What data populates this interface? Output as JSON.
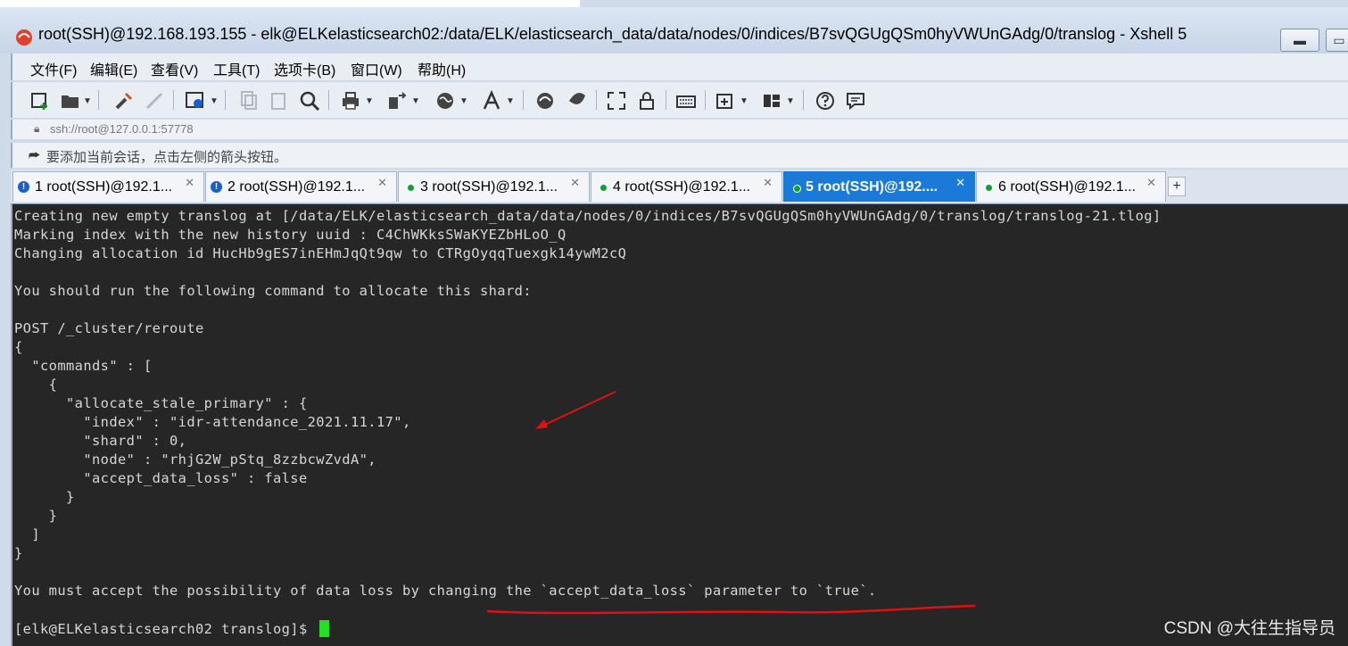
{
  "window": {
    "title": "root(SSH)@192.168.193.155 - elk@ELKelasticsearch02:/data/ELK/elasticsearch_data/data/nodes/0/indices/B7svQGUgQSm0hyVWUnGAdg/0/translog - Xshell 5"
  },
  "menu": {
    "items": [
      "文件(F)",
      "编辑(E)",
      "查看(V)",
      "工具(T)",
      "选项卡(B)",
      "窗口(W)",
      "帮助(H)"
    ]
  },
  "address": {
    "value": "ssh://root@127.0.0.1:57778"
  },
  "hint": {
    "text": "要添加当前会话，点击左侧的箭头按钮。"
  },
  "tabs": [
    {
      "label": "1 root(SSH)@192.1...",
      "status": "warning"
    },
    {
      "label": "2 root(SSH)@192.1...",
      "status": "warning"
    },
    {
      "label": "3 root(SSH)@192.1...",
      "status": "connected"
    },
    {
      "label": "4 root(SSH)@192.1...",
      "status": "connected"
    },
    {
      "label": "5 root(SSH)@192....",
      "status": "connected",
      "active": true
    },
    {
      "label": "6 root(SSH)@192.1...",
      "status": "connected"
    }
  ],
  "terminal": {
    "lines": [
      "Creating new empty translog at [/data/ELK/elasticsearch_data/data/nodes/0/indices/B7svQGUgQSm0hyVWUnGAdg/0/translog/translog-21.tlog]",
      "Marking index with the new history uuid : C4ChWKksSWaKYEZbHLoO_Q",
      "Changing allocation id HucHb9gES7inEHmJqQt9qw to CTRgOyqqTuexgk14ywM2cQ",
      "",
      "You should run the following command to allocate this shard:",
      "",
      "POST /_cluster/reroute",
      "{",
      "  \"commands\" : [",
      "    {",
      "      \"allocate_stale_primary\" : {",
      "        \"index\" : \"idr-attendance_2021.11.17\",",
      "        \"shard\" : 0,",
      "        \"node\" : \"rhjG2W_pStq_8zzbcwZvdA\",",
      "        \"accept_data_loss\" : false",
      "      }",
      "    }",
      "  ]",
      "}",
      "",
      "You must accept the possibility of data loss by changing the `accept_data_loss` parameter to `true`.",
      "",
      "[elk@ELKelasticsearch02 translog]$ "
    ]
  },
  "watermark": "CSDN @大往生指导员",
  "colors": {
    "terminal_bg": "#262626",
    "terminal_fg": "#d6d6d6",
    "cursor": "#22e022",
    "annotation": "#e01010",
    "active_tab": "#1b7ad8"
  }
}
